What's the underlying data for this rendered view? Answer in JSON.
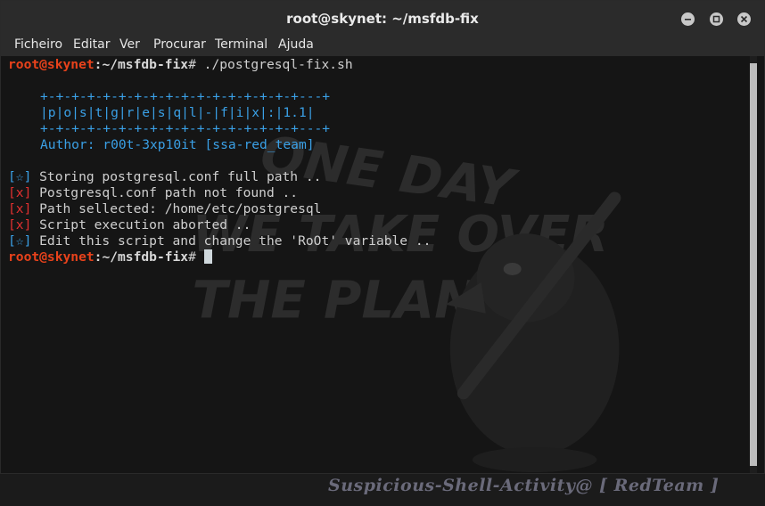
{
  "window": {
    "title": "root@skynet: ~/msfdb-fix",
    "buttons": [
      "minimize-icon",
      "maximize-icon",
      "close-icon"
    ]
  },
  "menubar": {
    "items": [
      "Ficheiro",
      "Editar",
      "Ver",
      "Procurar",
      "Terminal",
      "Ajuda"
    ]
  },
  "terminal": {
    "prompt_user": "root@skynet",
    "prompt_path": ":~/msfdb-fix",
    "prompt_symbol": "#",
    "command": " ./postgresql-fix.sh",
    "banner": [
      "+-+-+-+-+-+-+-+-+-+-+-+-+-+-+-+-+---+",
      "|p|o|s|t|g|r|e|s|q|l|-|f|i|x|:|1.1|",
      "+-+-+-+-+-+-+-+-+-+-+-+-+-+-+-+-+---+",
      "Author: r00t-3xp10it [ssa-red_team]"
    ],
    "messages": [
      {
        "tag": "[☆]",
        "text": " Storing postgresql.conf full path ..",
        "tag_color": "#3aa0e6"
      },
      {
        "tag": "[x]",
        "text": " Postgresql.conf path not found ..",
        "tag_color": "#e03030"
      },
      {
        "tag": "[x]",
        "text": " Path sellected: /home/etc/postgresql",
        "tag_color": "#e03030"
      },
      {
        "tag": "[x]",
        "text": " Script execution aborted ..",
        "tag_color": "#e03030"
      },
      {
        "tag": "[☆]",
        "text": " Edit this script and change the 'RoOt' variable ..",
        "tag_color": "#3aa0e6"
      }
    ],
    "watermark_lines": [
      "ONE DAY",
      "WE TAKE OVER",
      "THE PLANET"
    ]
  },
  "footer": {
    "signature": "Suspicious-Shell-Activity@ [ RedTeam ]"
  }
}
